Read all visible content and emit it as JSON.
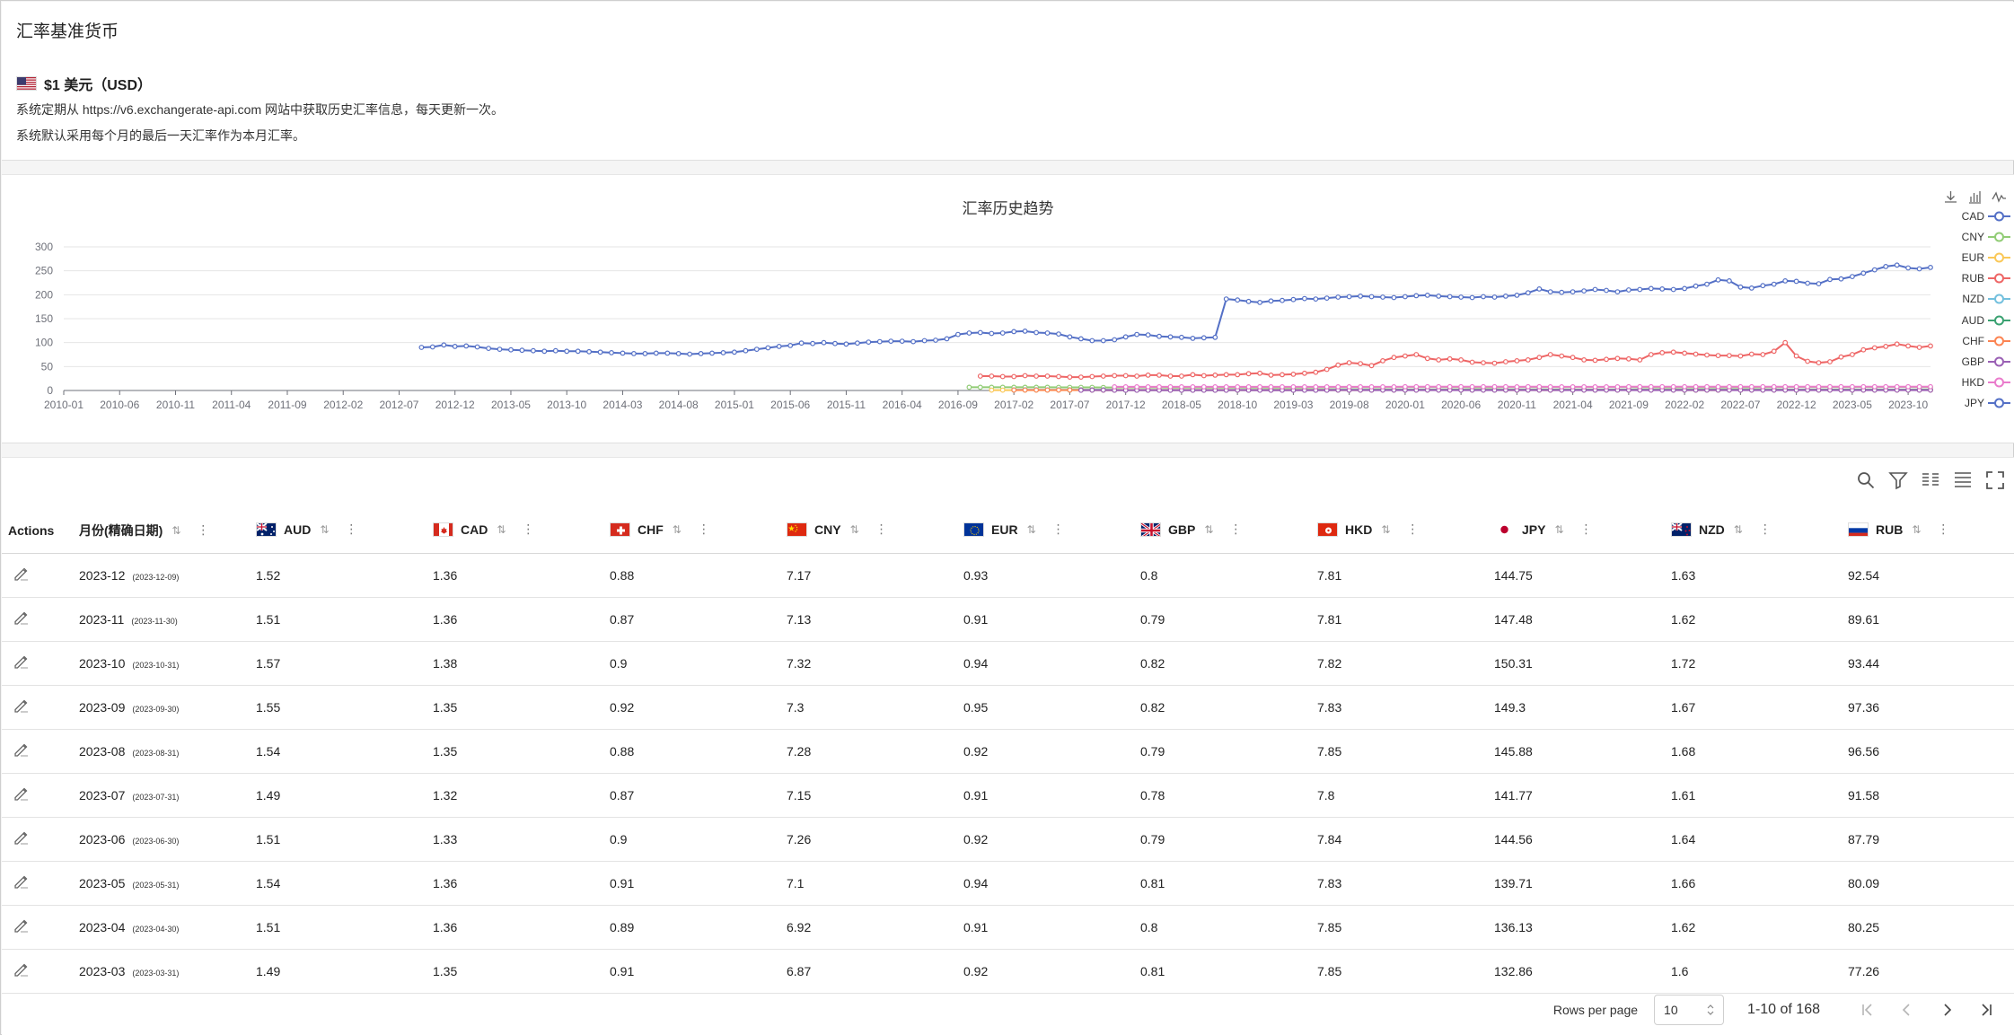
{
  "page": {
    "title": "汇率基准货币"
  },
  "base": {
    "label": "$1 美元（USD）",
    "info1": "系统定期从 https://v6.exchangerate-api.com 网站中获取历史汇率信息，每天更新一次。",
    "info2": "系统默认采用每个月的最后一天汇率作为本月汇率。"
  },
  "chart_data": {
    "type": "line",
    "title": "汇率历史趋势",
    "ylim": [
      0,
      300
    ],
    "yticks": [
      0,
      50,
      100,
      150,
      200,
      250,
      300
    ],
    "xticks": [
      "2010-01",
      "2010-06",
      "2010-11",
      "2011-04",
      "2011-09",
      "2012-02",
      "2012-07",
      "2012-12",
      "2013-05",
      "2013-10",
      "2014-03",
      "2014-08",
      "2015-01",
      "2015-06",
      "2015-11",
      "2016-04",
      "2016-09",
      "2017-02",
      "2017-07",
      "2017-12",
      "2018-05",
      "2018-10",
      "2019-03",
      "2019-08",
      "2020-01",
      "2020-06",
      "2020-11",
      "2021-04",
      "2021-09",
      "2022-02",
      "2022-07",
      "2022-12",
      "2023-05",
      "2023-10"
    ],
    "series": [
      {
        "name": "CAD",
        "color": "#5470c6",
        "values": [
          1.05,
          1.04,
          1.02,
          1.0,
          0.99,
          1.01,
          1.03,
          1.0,
          0.99,
          1.0,
          1.0,
          0.98,
          0.97,
          0.98,
          0.99,
          1.0,
          1.02,
          1.01,
          1.0,
          1.05,
          1.06,
          1.08,
          1.1,
          1.12,
          1.14,
          1.17,
          1.2,
          1.28,
          1.3,
          1.38,
          1.35,
          1.33,
          1.25,
          1.3,
          1.31,
          1.28,
          1.25,
          1.27,
          1.3,
          1.32,
          1.3,
          1.28,
          1.26,
          1.25,
          1.25,
          1.3,
          1.32,
          1.33,
          1.35,
          1.36,
          1.36,
          1.37,
          1.33,
          1.32,
          1.33,
          1.35,
          1.32,
          1.31,
          1.3,
          1.31,
          1.32,
          1.33,
          1.33,
          1.38,
          1.36,
          1.35,
          1.37,
          1.36,
          1.35,
          1.36,
          1.38,
          1.36,
          1.35,
          1.32,
          1.33,
          1.36,
          1.36,
          1.35,
          1.32,
          1.35,
          1.38,
          1.36,
          1.36
        ]
      },
      {
        "name": "CNY",
        "color": "#91cc75",
        "values": [
          6.83,
          6.83,
          6.83,
          6.83,
          6.82,
          6.8,
          6.74,
          6.67,
          6.6,
          6.6,
          6.55,
          6.47,
          6.46,
          6.35,
          6.32,
          6.3,
          6.32,
          6.29,
          6.25,
          6.23,
          6.21,
          6.15,
          6.14,
          6.12,
          6.1,
          6.06,
          6.12,
          6.15,
          6.16,
          6.2,
          6.21,
          6.36,
          6.36,
          6.5,
          6.48,
          6.6,
          6.55,
          6.63,
          6.68,
          6.9,
          6.93,
          6.89,
          6.88,
          6.78,
          6.66,
          6.41,
          6.3,
          6.37,
          6.88,
          6.73,
          6.86,
          6.72,
          6.9,
          6.76,
          7.16,
          7.04,
          6.96,
          6.99,
          7.08,
          7.07,
          6.6,
          6.54,
          6.45,
          6.46,
          6.48,
          6.37,
          6.36,
          6.45,
          6.44,
          6.37,
          6.31,
          6.58,
          6.71,
          7.1,
          7.3,
          7.18,
          6.9,
          6.95,
          7.0,
          7.1,
          7.26,
          7.15,
          7.28,
          7.3,
          7.32,
          7.13,
          7.17
        ]
      },
      {
        "name": "EUR",
        "color": "#fac858",
        "values": [
          0.7,
          0.73,
          0.74,
          0.75,
          0.81,
          0.81,
          0.77,
          0.77,
          0.73,
          0.73,
          0.72,
          0.7,
          0.69,
          0.71,
          0.75,
          0.73,
          0.76,
          0.77,
          0.81,
          0.78,
          0.75,
          0.76,
          0.77,
          0.78,
          0.76,
          0.76,
          0.75,
          0.73,
          0.73,
          0.73,
          0.72,
          0.73,
          0.78,
          0.82,
          0.88,
          0.89,
          0.93,
          0.91,
          0.9,
          0.89,
          0.91,
          0.91,
          0.94,
          0.92,
          0.9,
          0.87,
          0.84,
          0.84,
          0.85,
          0.83,
          0.82,
          0.86,
          0.87,
          0.85,
          0.87,
          0.89,
          0.91,
          0.89,
          0.92,
          0.91,
          0.89,
          0.9,
          0.82,
          0.82,
          0.83,
          0.84,
          0.86,
          0.9,
          0.88,
          0.94,
          1.0,
          1.0,
          0.97,
          0.94,
          0.92,
          0.92,
          0.93,
          0.92,
          0.91,
          0.92,
          0.94,
          0.95,
          0.94,
          0.91,
          0.93
        ]
      },
      {
        "name": "RUB",
        "color": "#ee6666",
        "values": [
          30,
          30,
          29,
          29,
          31,
          30,
          30,
          29,
          28,
          28,
          29,
          30,
          31,
          31,
          30,
          32,
          32,
          30,
          30,
          33,
          31,
          32,
          33,
          33,
          35,
          36,
          32,
          33,
          34,
          36,
          38,
          44,
          53,
          58,
          56,
          52,
          62,
          69,
          72,
          75,
          67,
          64,
          66,
          64,
          59,
          58,
          57,
          60,
          62,
          64,
          69,
          75,
          72,
          69,
          64,
          63,
          65,
          67,
          66,
          64,
          75,
          79,
          80,
          78,
          76,
          74,
          73,
          73,
          72,
          76,
          75,
          82,
          100,
          72,
          61,
          58,
          60,
          70,
          75,
          85,
          89,
          92,
          97,
          93,
          90,
          93
        ]
      },
      {
        "name": "NZD",
        "color": "#73c0de",
        "values": [
          1.4,
          1.42,
          1.41,
          1.36,
          1.41,
          1.36,
          1.3,
          1.3,
          1.25,
          1.21,
          1.18,
          1.23,
          1.3,
          1.26,
          1.24,
          1.25,
          1.22,
          1.22,
          1.24,
          1.2,
          1.19,
          1.24,
          1.29,
          1.22,
          1.2,
          1.16,
          1.17,
          1.21,
          1.26,
          1.28,
          1.36,
          1.45,
          1.5,
          1.48,
          1.46,
          1.5,
          1.47,
          1.4,
          1.38,
          1.38,
          1.44,
          1.42,
          1.38,
          1.4,
          1.45,
          1.48,
          1.5,
          1.52,
          1.55,
          1.49,
          1.48,
          1.5,
          1.52,
          1.55,
          1.57,
          1.59,
          1.62,
          1.55,
          1.52,
          1.5,
          1.45,
          1.42,
          1.4,
          1.43,
          1.47,
          1.45,
          1.5,
          1.55,
          1.62,
          1.75,
          1.7,
          1.65,
          1.58,
          1.6,
          1.62,
          1.66,
          1.64,
          1.61,
          1.68,
          1.67,
          1.72,
          1.62,
          1.63
        ]
      },
      {
        "name": "AUD",
        "color": "#3ba272",
        "values": [
          1.12,
          1.08,
          1.06,
          1.19,
          1.11,
          1.0,
          0.98,
          0.96,
          0.97,
          0.94,
          0.93,
          0.97,
          0.98,
          0.96,
          0.97,
          1.03,
          1.0,
          0.98,
          1.06,
          1.08,
          1.1,
          1.12,
          1.05,
          1.12,
          1.07,
          1.12,
          1.2,
          1.24,
          1.3,
          1.37,
          1.4,
          1.38,
          1.42,
          1.38,
          1.36,
          1.3,
          1.32,
          1.3,
          1.27,
          1.3,
          1.31,
          1.28,
          1.26,
          1.28,
          1.33,
          1.4,
          1.42,
          1.36,
          1.41,
          1.38,
          1.45,
          1.48,
          1.5,
          1.4,
          1.34,
          1.3,
          1.3,
          1.32,
          1.35,
          1.4,
          1.38,
          1.36,
          1.29,
          1.41,
          1.38,
          1.44,
          1.49,
          1.5,
          1.54,
          1.55,
          1.49,
          1.52,
          1.54,
          1.51,
          1.55,
          1.57,
          1.51,
          1.52
        ]
      },
      {
        "name": "CHF",
        "color": "#fc8452",
        "values": [
          1.03,
          1.03,
          1.0,
          0.98,
          0.93,
          0.91,
          0.89,
          0.85,
          0.79,
          0.84,
          0.9,
          0.93,
          0.95,
          0.91,
          0.93,
          0.92,
          0.94,
          0.94,
          0.93,
          0.91,
          0.92,
          0.89,
          0.88,
          0.91,
          0.9,
          0.9,
          0.98,
          0.96,
          0.99,
          1.0,
          1.01,
          0.97,
          0.96,
          0.97,
          1.0,
          0.98,
          0.97,
          0.99,
          0.98,
          0.95,
          0.96,
          0.98,
          1.0,
          0.99,
          1.01,
          0.97,
          0.99,
          0.95,
          0.91,
          0.92,
          0.94,
          0.92,
          0.9,
          0.88,
          0.9,
          0.92,
          0.91,
          0.92,
          0.93,
          0.92,
          0.91,
          0.88,
          0.87,
          0.9,
          0.91,
          0.89,
          0.87,
          0.88,
          0.92,
          0.9,
          0.91,
          0.9,
          0.9,
          0.91,
          0.92,
          0.91,
          0.9,
          0.87,
          0.88,
          0.92,
          0.9,
          0.87,
          0.88
        ]
      },
      {
        "name": "GBP",
        "color": "#9a60b4",
        "values": [
          0.62,
          0.66,
          0.67,
          0.64,
          0.62,
          0.64,
          0.64,
          0.62,
          0.64,
          0.63,
          0.62,
          0.62,
          0.61,
          0.63,
          0.66,
          0.63,
          0.62,
          0.61,
          0.6,
          0.6,
          0.59,
          0.61,
          0.65,
          0.66,
          0.7,
          0.67,
          0.66,
          0.69,
          0.78,
          0.81,
          0.8,
          0.77,
          0.74,
          0.76,
          0.77,
          0.75,
          0.71,
          0.74,
          0.77,
          0.78,
          0.8,
          0.78,
          0.76,
          0.79,
          0.81,
          0.77,
          0.75,
          0.78,
          0.79,
          0.8,
          0.82,
          0.81,
          0.8,
          0.82,
          0.83,
          0.82,
          0.8,
          0.79,
          0.78,
          0.8,
          0.83,
          0.81,
          0.8,
          0.79,
          0.8,
          0.81,
          0.82,
          0.81,
          0.8,
          0.8,
          0.79,
          0.78,
          0.79,
          0.82,
          0.82,
          0.79,
          0.8
        ]
      },
      {
        "name": "HKD",
        "color": "#ea7ccc",
        "values": [
          7.76,
          7.77,
          7.77,
          7.76,
          7.78,
          7.76,
          7.77,
          7.75,
          7.76,
          7.77,
          7.76,
          7.75,
          7.76,
          7.75,
          7.75,
          7.76,
          7.76,
          7.75,
          7.76,
          7.76,
          7.75,
          7.76,
          7.76,
          7.77,
          7.78,
          7.78,
          7.8,
          7.82,
          7.84,
          7.85,
          7.85,
          7.84,
          7.83,
          7.85,
          7.83,
          7.8,
          7.78,
          7.79,
          7.8,
          7.76,
          7.75,
          7.74,
          7.75,
          7.76,
          7.77,
          7.78,
          7.8,
          7.84,
          7.83,
          7.84,
          7.85,
          7.85,
          7.85,
          7.8,
          7.82,
          7.81,
          7.8,
          7.81,
          7.82,
          7.83,
          7.8,
          7.79,
          7.8,
          7.85,
          7.84,
          7.83,
          7.85,
          7.8,
          7.84,
          7.83,
          7.85,
          7.85,
          7.81,
          7.81
        ]
      },
      {
        "name": "JPY",
        "color": "#5470c6",
        "values": [
          90,
          91,
          95,
          92,
          93,
          91,
          88,
          86,
          85,
          84,
          83,
          82,
          83,
          82,
          82,
          81,
          80,
          79,
          78,
          77,
          77,
          78,
          78,
          77,
          76,
          77,
          78,
          79,
          80,
          83,
          86,
          89,
          92,
          94,
          99,
          98,
          100,
          98,
          97,
          99,
          101,
          102,
          103,
          103,
          102,
          104,
          105,
          108,
          117,
          120,
          121,
          119,
          120,
          123,
          124,
          121,
          120,
          118,
          112,
          108,
          104,
          104,
          106,
          112,
          117,
          116,
          113,
          112,
          111,
          109,
          110,
          111,
          191,
          189,
          186,
          184,
          187,
          188,
          190,
          192,
          191,
          193,
          195,
          196,
          197,
          196,
          195,
          194,
          196,
          198,
          199,
          197,
          196,
          195,
          194,
          196,
          195,
          197,
          199,
          204,
          212,
          206,
          205,
          206,
          208,
          211,
          209,
          206,
          210,
          211,
          213,
          212,
          211,
          213,
          218,
          222,
          231,
          229,
          216,
          214,
          219,
          222,
          229,
          228,
          224,
          223,
          232,
          233,
          238,
          245,
          252,
          259,
          262,
          256,
          254,
          257
        ]
      }
    ]
  },
  "legend": [
    "CAD",
    "CNY",
    "EUR",
    "RUB",
    "NZD",
    "AUD",
    "CHF",
    "GBP",
    "HKD",
    "JPY"
  ],
  "table": {
    "columns": {
      "actions": "Actions",
      "month": "月份(精确日期)",
      "aud": "AUD",
      "cad": "CAD",
      "chf": "CHF",
      "cny": "CNY",
      "eur": "EUR",
      "gbp": "GBP",
      "hkd": "HKD",
      "jpy": "JPY",
      "nzd": "NZD",
      "rub": "RUB"
    },
    "rows": [
      {
        "month": "2023-12",
        "date": "(2023-12-09)",
        "aud": "1.52",
        "cad": "1.36",
        "chf": "0.88",
        "cny": "7.17",
        "eur": "0.93",
        "gbp": "0.8",
        "hkd": "7.81",
        "jpy": "144.75",
        "nzd": "1.63",
        "rub": "92.54"
      },
      {
        "month": "2023-11",
        "date": "(2023-11-30)",
        "aud": "1.51",
        "cad": "1.36",
        "chf": "0.87",
        "cny": "7.13",
        "eur": "0.91",
        "gbp": "0.79",
        "hkd": "7.81",
        "jpy": "147.48",
        "nzd": "1.62",
        "rub": "89.61"
      },
      {
        "month": "2023-10",
        "date": "(2023-10-31)",
        "aud": "1.57",
        "cad": "1.38",
        "chf": "0.9",
        "cny": "7.32",
        "eur": "0.94",
        "gbp": "0.82",
        "hkd": "7.82",
        "jpy": "150.31",
        "nzd": "1.72",
        "rub": "93.44"
      },
      {
        "month": "2023-09",
        "date": "(2023-09-30)",
        "aud": "1.55",
        "cad": "1.35",
        "chf": "0.92",
        "cny": "7.3",
        "eur": "0.95",
        "gbp": "0.82",
        "hkd": "7.83",
        "jpy": "149.3",
        "nzd": "1.67",
        "rub": "97.36"
      },
      {
        "month": "2023-08",
        "date": "(2023-08-31)",
        "aud": "1.54",
        "cad": "1.35",
        "chf": "0.88",
        "cny": "7.28",
        "eur": "0.92",
        "gbp": "0.79",
        "hkd": "7.85",
        "jpy": "145.88",
        "nzd": "1.68",
        "rub": "96.56"
      },
      {
        "month": "2023-07",
        "date": "(2023-07-31)",
        "aud": "1.49",
        "cad": "1.32",
        "chf": "0.87",
        "cny": "7.15",
        "eur": "0.91",
        "gbp": "0.78",
        "hkd": "7.8",
        "jpy": "141.77",
        "nzd": "1.61",
        "rub": "91.58"
      },
      {
        "month": "2023-06",
        "date": "(2023-06-30)",
        "aud": "1.51",
        "cad": "1.33",
        "chf": "0.9",
        "cny": "7.26",
        "eur": "0.92",
        "gbp": "0.79",
        "hkd": "7.84",
        "jpy": "144.56",
        "nzd": "1.64",
        "rub": "87.79"
      },
      {
        "month": "2023-05",
        "date": "(2023-05-31)",
        "aud": "1.54",
        "cad": "1.36",
        "chf": "0.91",
        "cny": "7.1",
        "eur": "0.94",
        "gbp": "0.81",
        "hkd": "7.83",
        "jpy": "139.71",
        "nzd": "1.66",
        "rub": "80.09"
      },
      {
        "month": "2023-04",
        "date": "(2023-04-30)",
        "aud": "1.51",
        "cad": "1.36",
        "chf": "0.89",
        "cny": "6.92",
        "eur": "0.91",
        "gbp": "0.8",
        "hkd": "7.85",
        "jpy": "136.13",
        "nzd": "1.62",
        "rub": "80.25"
      },
      {
        "month": "2023-03",
        "date": "(2023-03-31)",
        "aud": "1.49",
        "cad": "1.35",
        "chf": "0.91",
        "cny": "6.87",
        "eur": "0.92",
        "gbp": "0.81",
        "hkd": "7.85",
        "jpy": "132.86",
        "nzd": "1.6",
        "rub": "77.26"
      }
    ]
  },
  "pagination": {
    "rows_per_page_label": "Rows per page",
    "rows_per_page": "10",
    "range": "1-10 of 168"
  },
  "colors": {
    "accent": "#5470c6"
  }
}
